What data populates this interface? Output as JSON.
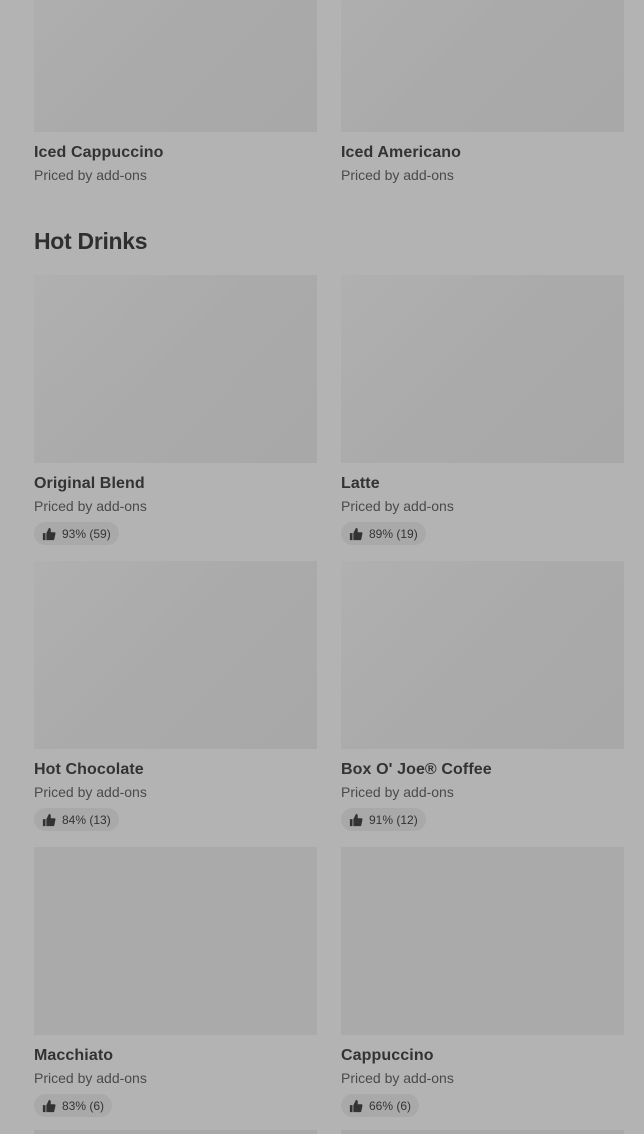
{
  "top_items": [
    {
      "name": "Iced Cappuccino",
      "price": "Priced by add-ons"
    },
    {
      "name": "Iced Americano",
      "price": "Priced by add-ons"
    }
  ],
  "hot_drinks": {
    "title": "Hot Drinks",
    "items": [
      {
        "name": "Original Blend",
        "price": "Priced by add-ons",
        "rating": "93% (59)"
      },
      {
        "name": "Latte",
        "price": "Priced by add-ons",
        "rating": "89% (19)"
      },
      {
        "name": "Hot Chocolate",
        "price": "Priced by add-ons",
        "rating": "84% (13)"
      },
      {
        "name": "Box O' Joe® Coffee",
        "price": "Priced by add-ons",
        "rating": "91% (12)"
      },
      {
        "name": "Macchiato",
        "price": "Priced by add-ons",
        "rating": "83% (6)"
      },
      {
        "name": "Cappuccino",
        "price": "Priced by add-ons",
        "rating": "66% (6)"
      }
    ]
  },
  "icons": {
    "rating": "thumbs-up-icon"
  },
  "colors": {
    "overlay_background": "#b3b3b3",
    "thumbnail": "#aaaaaa",
    "rating_pill": "#a9a9a9"
  }
}
